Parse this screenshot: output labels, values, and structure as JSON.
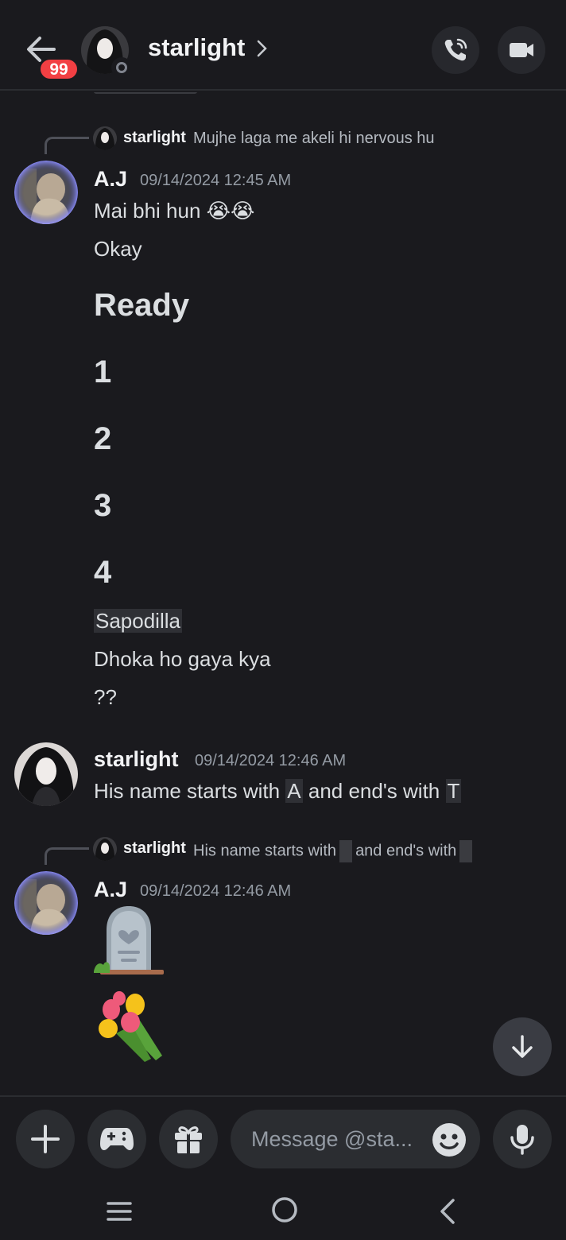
{
  "header": {
    "unread_badge": "99",
    "title": "starlight"
  },
  "messages": [
    {
      "reply": {
        "name": "starlight",
        "text": "Mujhe laga me akeli hi nervous hu"
      },
      "author": "A.J",
      "time": "09/14/2024 12:45 AM",
      "lines": [
        "Mai bhi hun 😭😭",
        "Okay",
        "Ready",
        "1",
        "2",
        "3",
        "4",
        "Sapodilla",
        "Dhoka ho gaya kya",
        "??"
      ]
    },
    {
      "author": "starlight",
      "time": "09/14/2024 12:46 AM",
      "text_parts": [
        "His name starts with ",
        "A",
        " and end's with ",
        "T"
      ]
    },
    {
      "reply": {
        "name": "starlight",
        "text_a": "His name starts with",
        "text_b": "and end's with"
      },
      "author": "A.J",
      "time": "09/14/2024 12:46 AM",
      "emoji_1": "🪦",
      "emoji_2": "💐"
    }
  ],
  "composer": {
    "placeholder": "Message @sta..."
  },
  "icons": [
    "back-arrow-icon",
    "chevron-right-icon",
    "phone-call-icon",
    "video-camera-icon",
    "arrow-down-icon",
    "plus-icon",
    "gamepad-icon",
    "gift-icon",
    "emoji-icon",
    "microphone-icon",
    "menu-icon",
    "home-circle-icon",
    "back-chevron-icon"
  ],
  "colors": {
    "badge": "#f23f43",
    "background": "#1a1a1e",
    "surface": "#2b2d31"
  }
}
